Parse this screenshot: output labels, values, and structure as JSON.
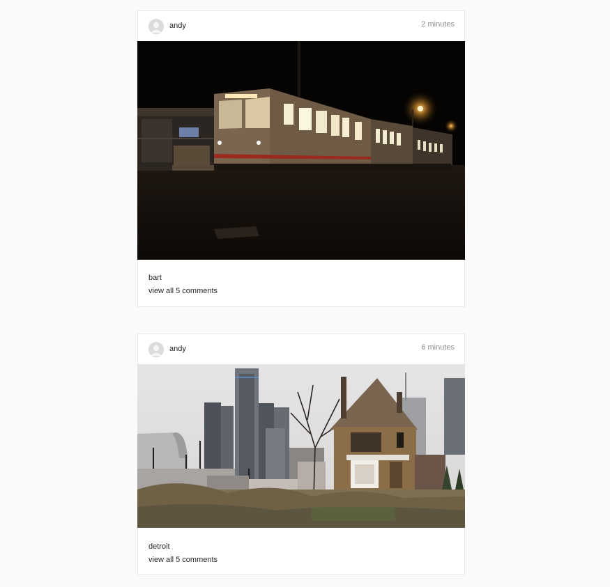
{
  "posts": [
    {
      "username": "andy",
      "time": "2 minutes",
      "photo_subject": "night-train",
      "caption": "bart",
      "comments_link": "view all 5 comments"
    },
    {
      "username": "andy",
      "time": "6 minutes",
      "photo_subject": "city-skyline-with-old-house",
      "caption": "detroit",
      "comments_link": "view all 5 comments"
    }
  ],
  "colors": {
    "background": "#fafafa",
    "card": "#ffffff",
    "border": "#e6e6e6",
    "muted_text": "#8e8e8e"
  }
}
